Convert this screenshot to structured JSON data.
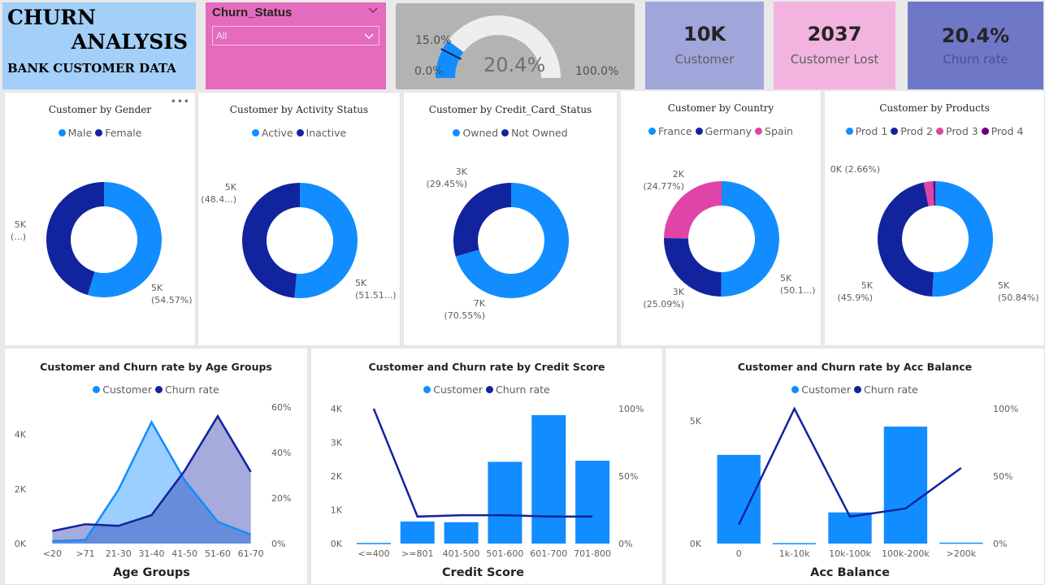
{
  "header": {
    "title_line1": "CHURN",
    "title_line2": "ANALYSIS",
    "subtitle": "BANK CUSTOMER DATA"
  },
  "slicer": {
    "title": "Churn_Status",
    "value": "All"
  },
  "gauge": {
    "value_label": "20.4%",
    "min_label": "0.0%",
    "max_label": "100.0%",
    "target_label": "15.0%",
    "value": 20.4,
    "target": 15.0
  },
  "kpis": [
    {
      "value": "10K",
      "label": "Customer"
    },
    {
      "value": "2037",
      "label": "Customer Lost"
    },
    {
      "value": "20.4%",
      "label": "Churn rate"
    }
  ],
  "colors": {
    "light_blue": "#118dff",
    "dark_blue": "#12239e",
    "pink": "#e044a7",
    "purple": "#6b007b",
    "kpi1_bg": "#a0a6da",
    "kpi2_bg": "#f2b4de",
    "kpi3_bg": "#6e78c7",
    "gauge_bg": "#b3b3b3"
  },
  "chart_data": [
    {
      "id": "gender",
      "type": "pie",
      "title": "Customer by Gender",
      "legend": [
        "Male",
        "Female"
      ],
      "values": [
        54.57,
        45.43
      ],
      "labels": [
        {
          "line1": "5K",
          "line2": "(54.57%)"
        },
        {
          "line1": "5K",
          "line2": "(...)"
        }
      ]
    },
    {
      "id": "activity",
      "type": "pie",
      "title": "Customer by Activity Status",
      "legend": [
        "Active",
        "Inactive"
      ],
      "values": [
        51.51,
        48.49
      ],
      "labels": [
        {
          "line1": "5K",
          "line2": "(51.51...)"
        },
        {
          "line1": "5K",
          "line2": "(48.4...)"
        }
      ]
    },
    {
      "id": "creditcard",
      "type": "pie",
      "title": "Customer by Credit_Card_Status",
      "legend": [
        "Owned",
        "Not Owned"
      ],
      "values": [
        70.55,
        29.45
      ],
      "labels": [
        {
          "line1": "7K",
          "line2": "(70.55%)"
        },
        {
          "line1": "3K",
          "line2": "(29.45%)"
        }
      ]
    },
    {
      "id": "country",
      "type": "pie",
      "title": "Customer by Country",
      "legend": [
        "France",
        "Germany",
        "Spain"
      ],
      "values": [
        50.14,
        25.09,
        24.77
      ],
      "labels": [
        {
          "line1": "5K",
          "line2": "(50.1...)"
        },
        {
          "line1": "3K",
          "line2": "(25.09%)"
        },
        {
          "line1": "2K",
          "line2": "(24.77%)"
        }
      ]
    },
    {
      "id": "products",
      "type": "pie",
      "title": "Customer by Products",
      "legend": [
        "Prod 1",
        "Prod 2",
        "Prod 3",
        "Prod 4"
      ],
      "values": [
        50.84,
        45.9,
        2.66,
        0.6
      ],
      "labels": [
        {
          "line1": "5K",
          "line2": "(50.84%)"
        },
        {
          "line1": "5K",
          "line2": "(45.9%)"
        },
        {
          "line1": "0K (2.66%)",
          "line2": ""
        }
      ]
    },
    {
      "id": "age",
      "type": "area",
      "title": "Customer and Churn rate by Age Groups",
      "legend": [
        "Customer",
        "Churn rate"
      ],
      "xlabel": "Age Groups",
      "categories": [
        "<20",
        ">71",
        "21-30",
        "31-40",
        "41-50",
        "51-60",
        "61-70"
      ],
      "series": [
        {
          "name": "Customer",
          "values": [
            90,
            130,
            1970,
            4450,
            2320,
            800,
            330
          ]
        },
        {
          "name": "Churn rate",
          "values": [
            5.5,
            8.5,
            7.8,
            12.5,
            32,
            56,
            31.5
          ]
        }
      ],
      "y_left_ticks": [
        "0K",
        "2K",
        "4K"
      ],
      "y_right_ticks": [
        "0%",
        "20%",
        "40%",
        "60%"
      ],
      "ylim_left": [
        0,
        5000
      ],
      "ylim_right": [
        0,
        60
      ]
    },
    {
      "id": "credit",
      "type": "bar",
      "title": "Customer and Churn rate by Credit Score",
      "legend": [
        "Customer",
        "Churn rate"
      ],
      "xlabel": "Credit Score",
      "categories": [
        "<=400",
        ">=801",
        "401-500",
        "501-600",
        "601-700",
        "701-800"
      ],
      "series": [
        {
          "name": "Customer",
          "values": [
            19,
            655,
            634,
            2424,
            3810,
            2458
          ]
        },
        {
          "name": "Churn rate",
          "values": [
            100,
            20,
            21,
            21,
            20,
            20
          ]
        }
      ],
      "y_left_ticks": [
        "0K",
        "1K",
        "2K",
        "3K",
        "4K"
      ],
      "y_right_ticks": [
        "0%",
        "50%",
        "100%"
      ],
      "ylim_left": [
        0,
        4000
      ],
      "ylim_right": [
        0,
        100
      ]
    },
    {
      "id": "balance",
      "type": "bar",
      "title": "Customer and Churn rate by Acc Balance",
      "legend": [
        "Customer",
        "Churn rate"
      ],
      "xlabel": "Acc Balance",
      "categories": [
        "0",
        "1k-10k",
        "10k-100k",
        "100k-200k",
        ">200k"
      ],
      "series": [
        {
          "name": "Customer",
          "values": [
            3617,
            20,
            1270,
            4770,
            40
          ]
        },
        {
          "name": "Churn rate",
          "values": [
            14,
            100,
            20,
            26,
            56
          ]
        }
      ],
      "y_left_ticks": [
        "0K",
        "5K"
      ],
      "y_right_ticks": [
        "0%",
        "50%",
        "100%"
      ],
      "ylim_left": [
        0,
        5500
      ],
      "ylim_right": [
        0,
        100
      ]
    }
  ]
}
